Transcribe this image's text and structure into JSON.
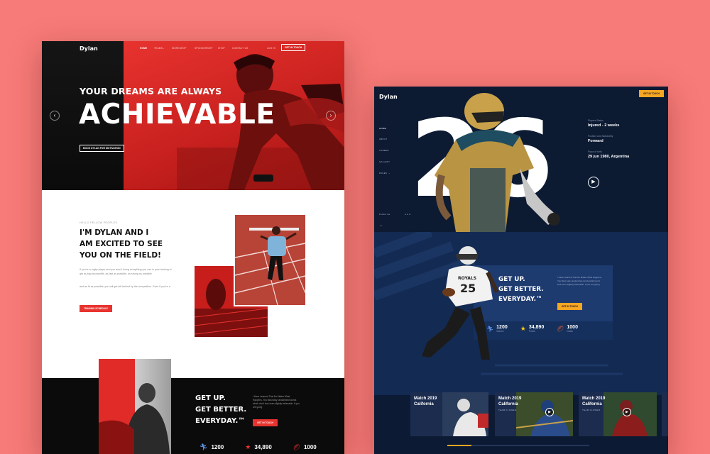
{
  "left_site": {
    "brand": "Dylan",
    "nav": [
      "HOME",
      "TEAMS",
      "WORKSHOP",
      "SPONSORSHIP",
      "SHOP",
      "CONTACT US"
    ],
    "login": "LOG IN",
    "cta": "GET IN TOUCH",
    "hero": {
      "line1": "YOUR DREAMS ARE ALWAYS",
      "line2": "ACHIEVABLE",
      "button": "BOOK DYLAN FOR MOTIVATION"
    },
    "about": {
      "eyebrow": "HELLO FELLOW PEOPLES",
      "heading_lines": [
        "I'M DYLAN AND I",
        "AM EXCITED TO SEE",
        "YOU ON THE FIELD!"
      ],
      "para1": "If you're a rugby player and you aren't doing everything you can in your training to get as big as possible, as fast as possible, as strong as possible",
      "para2": "and as fit as possible, you will get left behind by the competition. Even if you're a",
      "button": "TRAINING SCHEDULE"
    },
    "motivation": {
      "lines": [
        "GET UP.",
        "GET BETTER.",
        "EVERYDAY.™"
      ],
      "text": "I Have Learned That No Matter What Happens, You Must stay randomized words which don't look even slightly believable. If you are going",
      "button": "GET IN TOUCH"
    },
    "stats": [
      {
        "value": "1200",
        "icon": "runner-icon"
      },
      {
        "value": "34,890",
        "icon": "star-icon"
      },
      {
        "value": "1000",
        "icon": "football-icon"
      }
    ]
  },
  "right_site": {
    "brand": "Dylan",
    "cta": "GET IN TOUCH",
    "nav": [
      "HOME",
      "ABOUT",
      "CAREER",
      "GALLERY",
      "PAGES"
    ],
    "follow": "Follow me",
    "big_number": "26",
    "info": [
      {
        "label": "Players Status",
        "value": "Injured - 2 weeks"
      },
      {
        "label": "Position and Nationality",
        "value": "Forward"
      },
      {
        "label": "Place of birth",
        "value": "29 jun 1980, Argentina"
      }
    ],
    "motivation": {
      "lines": [
        "GET UP.",
        "GET BETTER.",
        "EVERYDAY.™"
      ],
      "text": "I Have Learned That No Matter What Happens, You Must stay randomized words which don't look even slightly believable. If you are going",
      "button": "GET IN TOUCH"
    },
    "stats": [
      {
        "value": "1200",
        "label": "Games",
        "icon": "runner-icon"
      },
      {
        "value": "34,890",
        "label": "Points",
        "icon": "star-icon"
      },
      {
        "value": "1000",
        "label": "Goals",
        "icon": "football-icon"
      }
    ],
    "jersey": {
      "name": "ROYALS",
      "number": "25"
    },
    "matches": [
      {
        "title": "Match 2019",
        "place": "California",
        "sub": "TEAM FLOWER"
      },
      {
        "title": "Match 2019",
        "place": "California",
        "sub": "TEAM FLOWER"
      },
      {
        "title": "Match 2019",
        "place": "California",
        "sub": "TEAM FLOWER"
      }
    ]
  },
  "colors": {
    "page_bg": "#f77b78",
    "red": "#e8332f",
    "navy": "#0f1e38",
    "yellow": "#f5a623"
  }
}
